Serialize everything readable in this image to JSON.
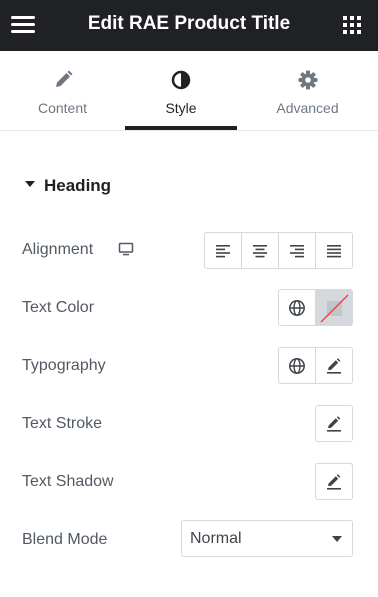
{
  "header": {
    "title": "Edit RAE Product Title"
  },
  "tabs": [
    {
      "label": "Content",
      "icon": "pencil-icon"
    },
    {
      "label": "Style",
      "icon": "half-circle-icon",
      "active": true
    },
    {
      "label": "Advanced",
      "icon": "gear-icon"
    }
  ],
  "section": {
    "title": "Heading",
    "expanded": true
  },
  "controls": {
    "alignment": {
      "label": "Alignment",
      "responsive_icon": "desktop-icon",
      "options": [
        "align-left-icon",
        "align-center-icon",
        "align-right-icon",
        "align-justify-icon"
      ]
    },
    "text_color": {
      "label": "Text Color",
      "value": "none"
    },
    "typography": {
      "label": "Typography"
    },
    "text_stroke": {
      "label": "Text Stroke"
    },
    "text_shadow": {
      "label": "Text Shadow"
    },
    "blend_mode": {
      "label": "Blend Mode",
      "value": "Normal"
    }
  },
  "colors": {
    "header_bg": "#1f2124",
    "active_tab": "#1f2124",
    "border": "#d5d8dc",
    "no_color_line": "#e8414d"
  }
}
